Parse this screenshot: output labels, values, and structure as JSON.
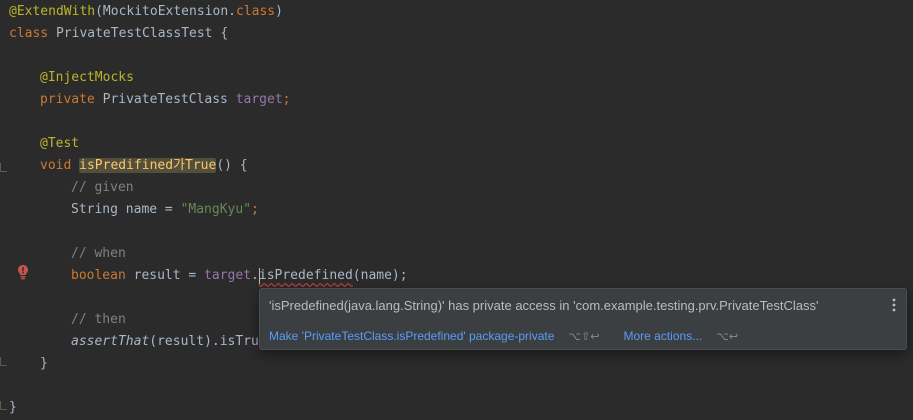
{
  "code": {
    "l1_ann": "@ExtendWith",
    "l1_rest": "(MockitoExtension.",
    "l1_kw": "class",
    "l1_end": ")",
    "l2_kw": "class",
    "l2_name": " PrivateTestClassTest {",
    "l4_ann": "@InjectMocks",
    "l5_kw": "private",
    "l5_type": " PrivateTestClass ",
    "l5_field": "target",
    "l5_end": ";",
    "l7_ann": "@Test",
    "l8_kw": "void",
    "l8_method": "isPredifined가True",
    "l8_end": "() {",
    "l9_cmt": "// given",
    "l10_type": "String name = ",
    "l10_str": "\"MangKyu\"",
    "l10_end": ";",
    "l12_cmt": "// when",
    "l13_kw": "boolean",
    "l13_mid": " result = ",
    "l13_field": "target",
    "l13_dot": ".",
    "l13_err": "isPredefined",
    "l13_end": "(name);",
    "l15_cmt": "// then",
    "l16_method": "assertThat",
    "l16_end": "(result).isTru",
    "l17": "}",
    "l19": "}"
  },
  "popup": {
    "message": "'isPredefined(java.lang.String)' has private access in 'com.example.testing.prv.PrivateTestClass'",
    "action_primary": "Make 'PrivateTestClass.isPredefined' package-private",
    "action_primary_shortcut": "⌥⇧↩",
    "action_more": "More actions...",
    "action_more_shortcut": "⌥↩"
  },
  "icons": {
    "gutter": "error-bulb-icon",
    "menu": "more-vertical-icon"
  },
  "colors": {
    "background": "#2b2b2b",
    "annotation": "#bbb529",
    "keyword": "#cc7832",
    "string": "#6a8759",
    "comment": "#808080",
    "method": "#ffc66d",
    "field": "#9876aa",
    "link": "#589df6",
    "error": "#bc3f3c"
  }
}
